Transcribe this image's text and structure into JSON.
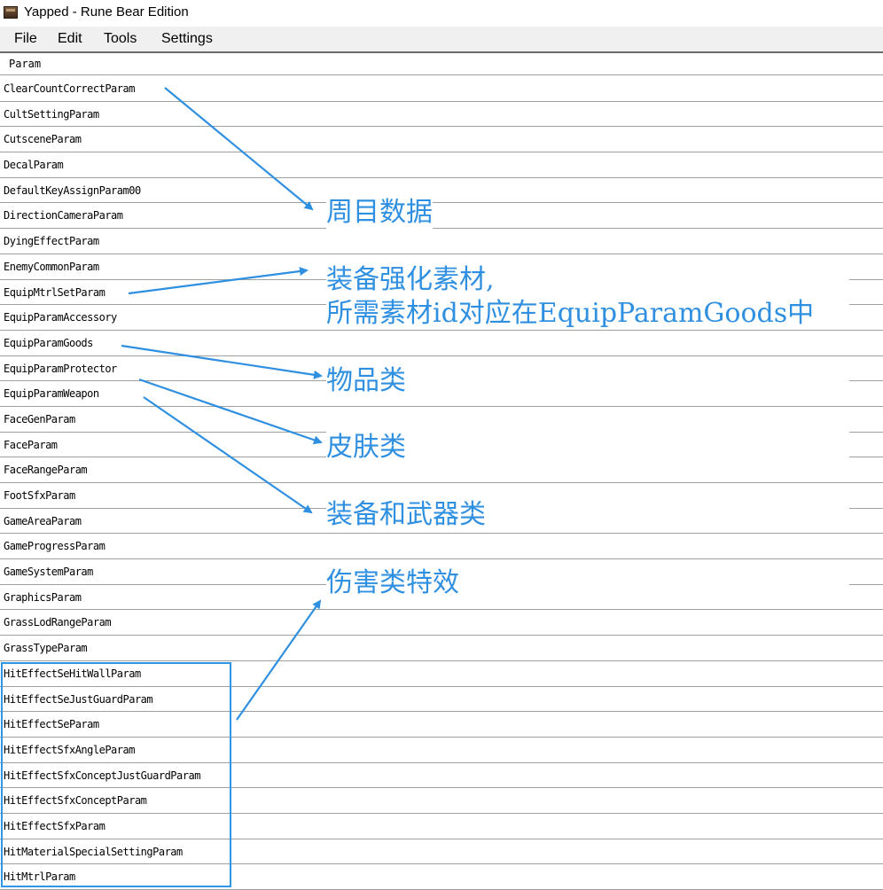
{
  "window": {
    "title": "Yapped - Rune Bear Edition",
    "icon": "app-chest-icon"
  },
  "menu": [
    "File",
    "Edit",
    "Tools",
    "Settings"
  ],
  "grid": {
    "column_header": "Param",
    "rows": [
      "ClearCountCorrectParam",
      "CultSettingParam",
      "CutsceneParam",
      "DecalParam",
      "DefaultKeyAssignParam00",
      "DirectionCameraParam",
      "DyingEffectParam",
      "EnemyCommonParam",
      "EquipMtrlSetParam",
      "EquipParamAccessory",
      "EquipParamGoods",
      "EquipParamProtector",
      "EquipParamWeapon",
      "FaceGenParam",
      "FaceParam",
      "FaceRangeParam",
      "FootSfxParam",
      "GameAreaParam",
      "GameProgressParam",
      "GameSystemParam",
      "GraphicsParam",
      "GrassLodRangeParam",
      "GrassTypeParam",
      "HitEffectSeHitWallParam",
      "HitEffectSeJustGuardParam",
      "HitEffectSeParam",
      "HitEffectSfxAngleParam",
      "HitEffectSfxConceptJustGuardParam",
      "HitEffectSfxConceptParam",
      "HitEffectSfxParam",
      "HitMaterialSpecialSettingParam",
      "HitMtrlParam"
    ]
  },
  "annotations": {
    "cycle_data": "周目数据",
    "upgrade_line1": "装备强化素材,",
    "upgrade_line2": "所需素材id对应在EquipParamGoods中",
    "goods": "物品类",
    "skins": "皮肤类",
    "gear_weapons": "装备和武器类",
    "damage_effects": "伤害类特效",
    "color": "#2f8fe0"
  }
}
